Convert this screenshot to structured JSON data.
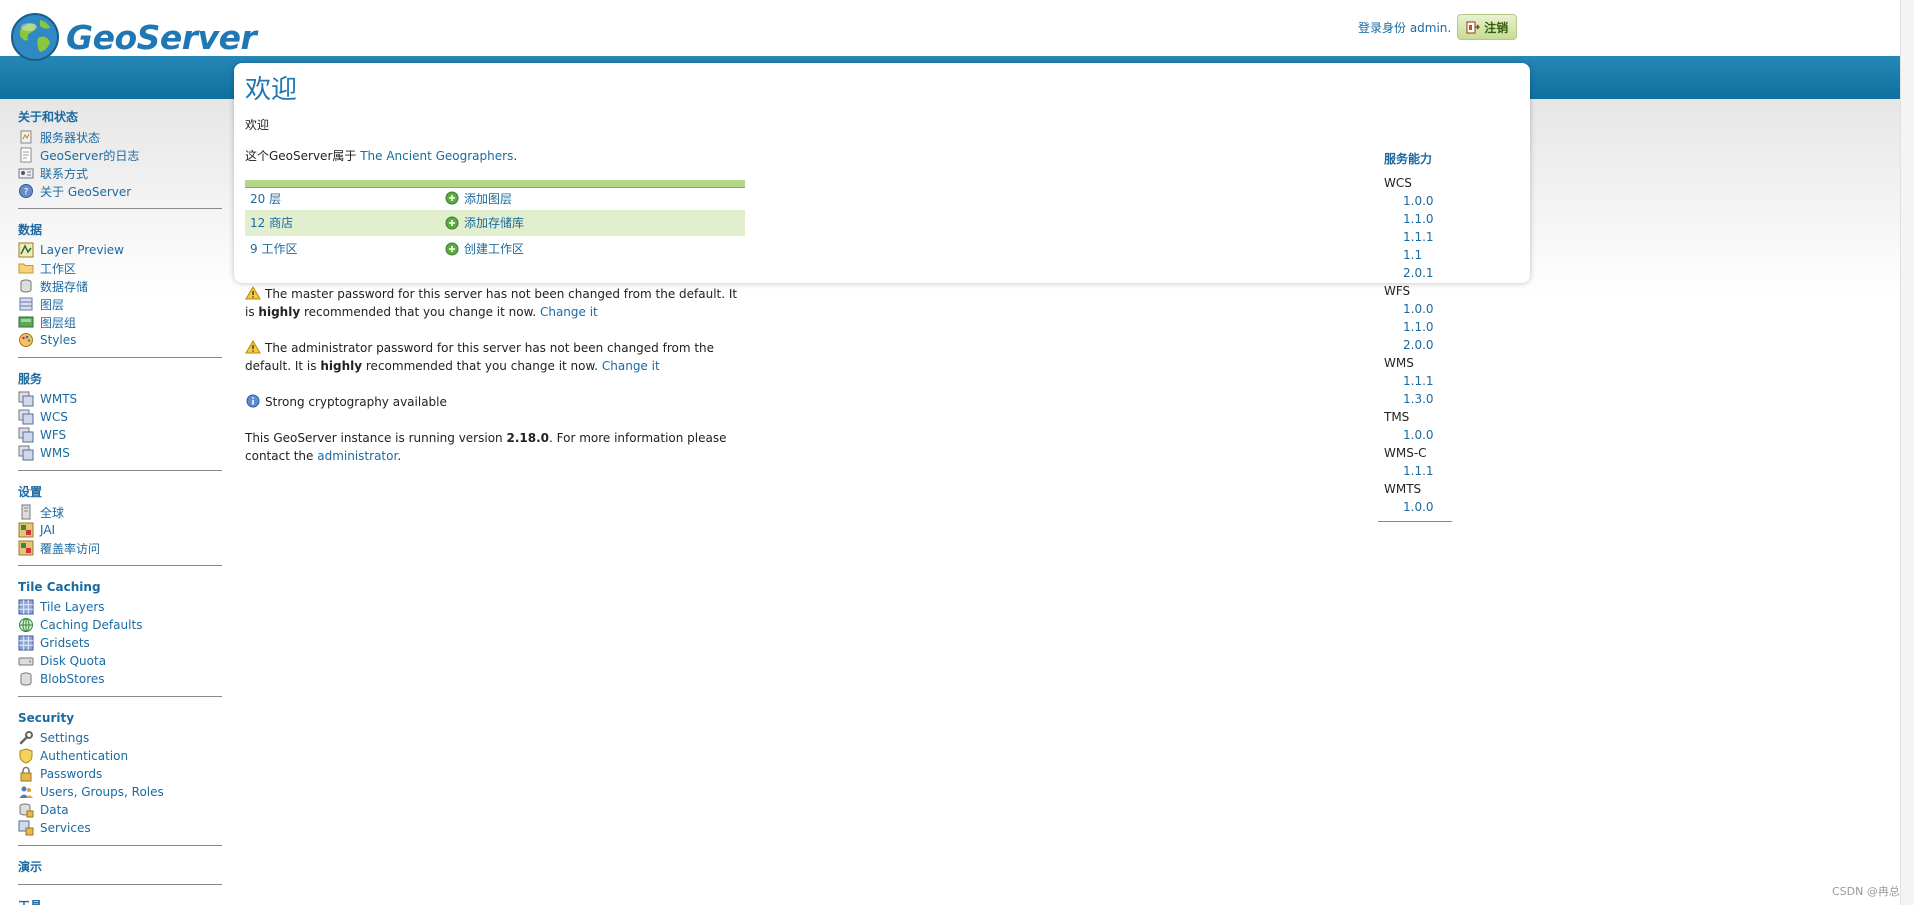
{
  "header": {
    "logo_text": "GeoServer",
    "login_text": "登录身份 admin.",
    "logout_label": "注销"
  },
  "sidebar": {
    "sections": [
      {
        "heading": "关于和状态",
        "items": [
          "服务器状态",
          "GeoServer的日志",
          "联系方式",
          "关于 GeoServer"
        ]
      },
      {
        "heading": "数据",
        "items": [
          "Layer Preview",
          "工作区",
          "数据存储",
          "图层",
          "图层组",
          "Styles"
        ]
      },
      {
        "heading": "服务",
        "items": [
          "WMTS",
          "WCS",
          "WFS",
          "WMS"
        ]
      },
      {
        "heading": "设置",
        "items": [
          "全球",
          "JAI",
          "覆盖率访问"
        ]
      },
      {
        "heading": "Tile Caching",
        "items": [
          "Tile Layers",
          "Caching Defaults",
          "Gridsets",
          "Disk Quota",
          "BlobStores"
        ]
      },
      {
        "heading": "Security",
        "items": [
          "Settings",
          "Authentication",
          "Passwords",
          "Users, Groups, Roles",
          "Data",
          "Services"
        ]
      },
      {
        "heading": "演示",
        "items": []
      },
      {
        "heading": "工具",
        "items": []
      }
    ]
  },
  "main": {
    "title": "欢迎",
    "welcome": "欢迎",
    "belongs_prefix": "这个GeoServer属于",
    "belongs_link": "The Ancient Geographers",
    "belongs_suffix": ".",
    "stats": [
      {
        "count": "20 层",
        "action": "添加图层"
      },
      {
        "count": "12 商店",
        "action": "添加存储库"
      },
      {
        "count": "9 工作区",
        "action": "创建工作区"
      }
    ],
    "master_pw_1": "The master password for this server has not been changed from the default. It is",
    "master_pw_bold": "highly",
    "master_pw_2": "recommended that you change it now.",
    "master_pw_link": "Change it",
    "admin_pw_1": "The administrator password for this server has not been changed from the default. It is",
    "admin_pw_bold": "highly",
    "admin_pw_2": "recommended that you change it now.",
    "admin_pw_link": "Change it",
    "crypto": "Strong cryptography available",
    "version_1": "This GeoServer instance is running version",
    "version_bold": "2.18.0",
    "version_2": ". For more information please contact the",
    "version_link": "administrator",
    "version_3": "."
  },
  "capabilities": {
    "title": "服务能力",
    "services": [
      {
        "name": "WCS",
        "versions": [
          "1.0.0",
          "1.1.0",
          "1.1.1",
          "1.1",
          "2.0.1"
        ]
      },
      {
        "name": "WFS",
        "versions": [
          "1.0.0",
          "1.1.0",
          "2.0.0"
        ]
      },
      {
        "name": "WMS",
        "versions": [
          "1.1.1",
          "1.3.0"
        ]
      },
      {
        "name": "TMS",
        "versions": [
          "1.0.0"
        ]
      },
      {
        "name": "WMS-C",
        "versions": [
          "1.1.1"
        ]
      },
      {
        "name": "WMTS",
        "versions": [
          "1.0.0"
        ]
      }
    ]
  },
  "footer": {
    "mark": "CSDN @冉总"
  },
  "colors": {
    "accent": "#1b6aa0",
    "band": "#1a7cad",
    "table_highlight": "#e2efce",
    "table_rule": "#b5d68a"
  }
}
